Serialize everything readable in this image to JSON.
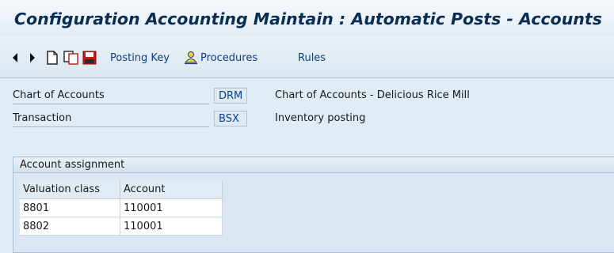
{
  "window": {
    "title": "Configuration Accounting Maintain : Automatic Posts - Accounts"
  },
  "toolbar": {
    "icons": [
      "back-arrow-icon",
      "forward-arrow-icon",
      "new-document-icon",
      "copy-icon",
      "save-icon"
    ],
    "posting_key_label": "Posting Key",
    "procedures_label": "Procedures",
    "rules_label": "Rules"
  },
  "header_fields": [
    {
      "label": "Chart of Accounts",
      "value": "DRM",
      "description": "Chart of Accounts - Delicious Rice Mill"
    },
    {
      "label": "Transaction",
      "value": "BSX",
      "description": "Inventory posting"
    }
  ],
  "account_assignment": {
    "title": "Account assignment",
    "columns": [
      "Valuation class",
      "Account"
    ],
    "rows": [
      [
        "8801",
        "110001"
      ],
      [
        "8802",
        "110001"
      ]
    ]
  },
  "colors": {
    "background": "#dfebf5",
    "title_text": "#0a2d52",
    "link_text": "#0e3f7a",
    "key_text": "#0b3f8a"
  }
}
